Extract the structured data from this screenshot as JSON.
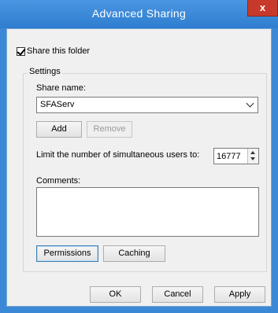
{
  "window": {
    "title": "Advanced Sharing",
    "close_glyph": "x"
  },
  "share_folder": {
    "label": "Share this folder",
    "checked": true
  },
  "settings": {
    "group_label": "Settings",
    "share_name_label": "Share name:",
    "share_name_value": "SFAServ",
    "add_label": "Add",
    "remove_label": "Remove",
    "limit_label": "Limit the number of simultaneous users to:",
    "limit_value": "16777",
    "comments_label": "Comments:",
    "comments_value": "",
    "permissions_label": "Permissions",
    "caching_label": "Caching"
  },
  "footer": {
    "ok_label": "OK",
    "cancel_label": "Cancel",
    "apply_label": "Apply"
  },
  "colors": {
    "titlebar": "#2f7dcf",
    "close": "#c7392a",
    "panel": "#f0f0f0"
  }
}
